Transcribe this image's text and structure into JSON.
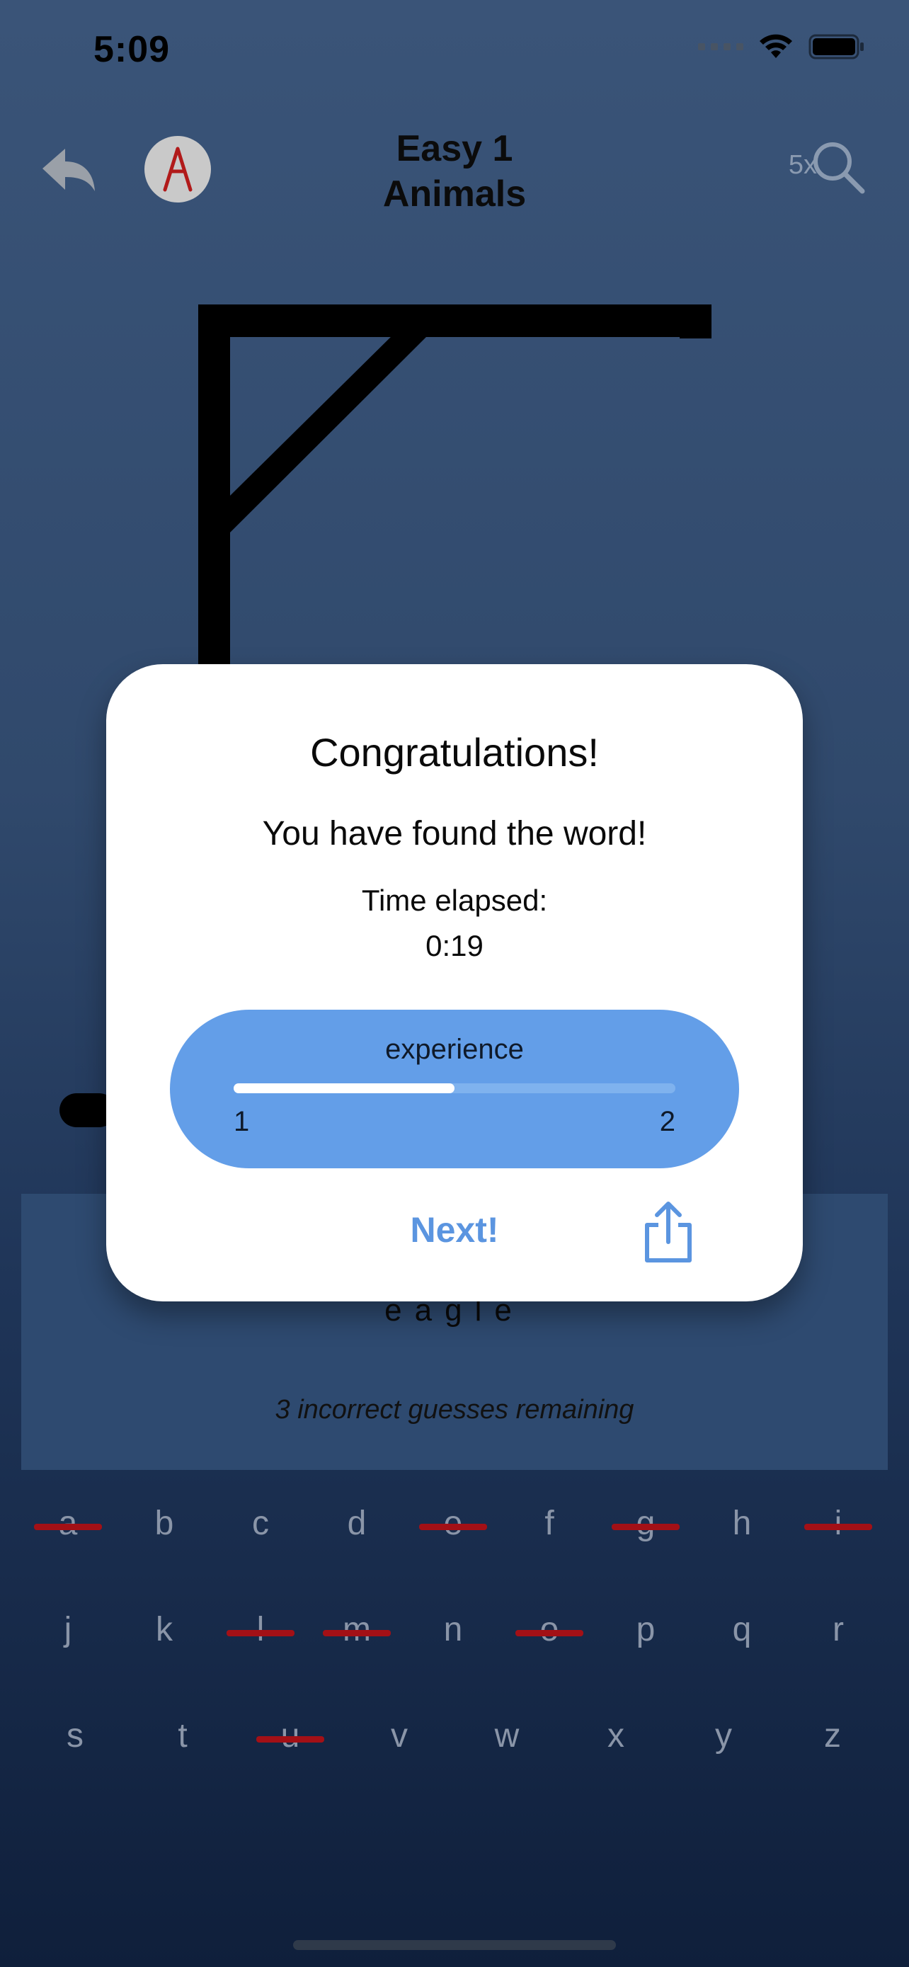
{
  "status_bar": {
    "time": "5:09"
  },
  "header": {
    "title_line1": "Easy 1",
    "title_line2": "Animals",
    "hint_count": "5x"
  },
  "game": {
    "word": "eagle",
    "remaining_text": "3 incorrect guesses remaining"
  },
  "keyboard": {
    "rows": [
      [
        "a",
        "b",
        "c",
        "d",
        "e",
        "f",
        "g",
        "h",
        "i"
      ],
      [
        "j",
        "k",
        "l",
        "m",
        "n",
        "o",
        "p",
        "q",
        "r"
      ],
      [
        "s",
        "t",
        "u",
        "v",
        "w",
        "x",
        "y",
        "z"
      ]
    ],
    "struck": [
      "a",
      "e",
      "g",
      "i",
      "l",
      "m",
      "o",
      "u"
    ]
  },
  "modal": {
    "title": "Congratulations!",
    "subtitle": "You have found the word!",
    "time_label": "Time elapsed:",
    "time_value": "0:19",
    "experience_label": "experience",
    "level_from": "1",
    "level_to": "2",
    "progress_fraction": 0.5,
    "next_label": "Next!"
  },
  "colors": {
    "accent": "#639ee8",
    "next_text": "#5b95e0",
    "strike": "#a31016"
  }
}
